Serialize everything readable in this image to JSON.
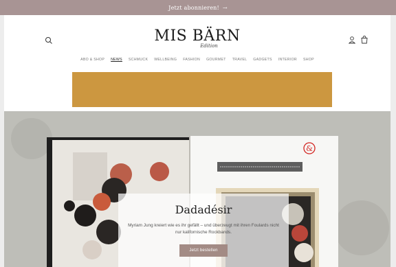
{
  "announcement": {
    "text": "Jetzt abonnieren!",
    "arrow": "→"
  },
  "header": {
    "logo_main": "MIS BÄRN",
    "logo_sub": "Edition",
    "icons": [
      "search-icon",
      "account-icon",
      "cart-icon"
    ]
  },
  "nav": {
    "items": [
      "ABO & SHOP",
      "NEWS",
      "SCHMUCK",
      "WELLBEING",
      "FASHION",
      "GOURMET",
      "TRAVEL",
      "GADGETS",
      "INTERIOR",
      "SHOP"
    ],
    "active": "NEWS"
  },
  "banner": {
    "color": "#cc9740"
  },
  "hero": {
    "title": "Dadadésir",
    "text": "Myriam Jung kreiert wie es ihr gefällt – und überzeugt mit ihren Foulards nicht nur kalifornische Rockbands.",
    "button": "Jetzt bestellen",
    "badge": "&"
  },
  "colors": {
    "announce_bg": "#a89494",
    "button_bg": "#a38b85"
  }
}
